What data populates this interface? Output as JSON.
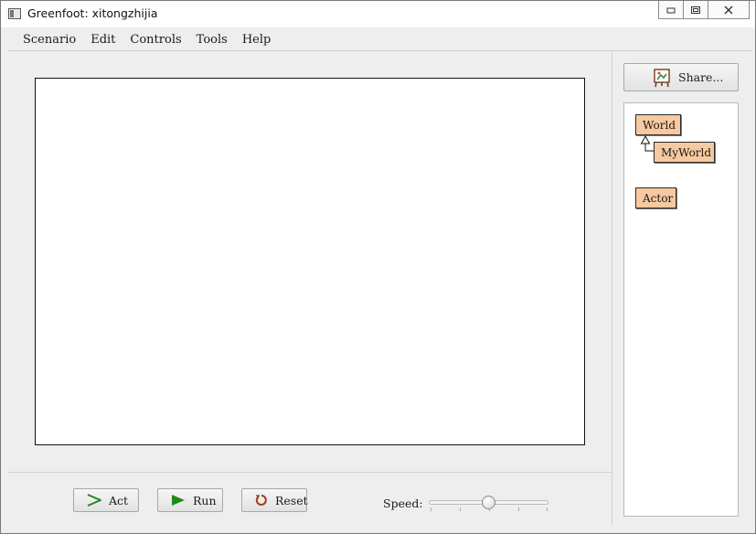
{
  "window": {
    "title": "Greenfoot: xitongzhijia",
    "controls": [
      "minimize-icon",
      "restore-icon",
      "close-icon"
    ]
  },
  "menu": {
    "items": [
      "Scenario",
      "Edit",
      "Controls",
      "Tools",
      "Help"
    ]
  },
  "controls": {
    "act_label": "Act",
    "run_label": "Run",
    "reset_label": "Reset",
    "speed_label": "Speed:",
    "speed_value": 0.5
  },
  "sidebar": {
    "share_label": "Share...",
    "classes": {
      "world": "World",
      "myworld": "MyWorld",
      "actor": "Actor"
    }
  },
  "colors": {
    "class_fill": "#f6c9a0",
    "run_icon": "#1e8a1e",
    "act_icon": "#1e8a1e",
    "reset_icon": "#a0401a"
  }
}
